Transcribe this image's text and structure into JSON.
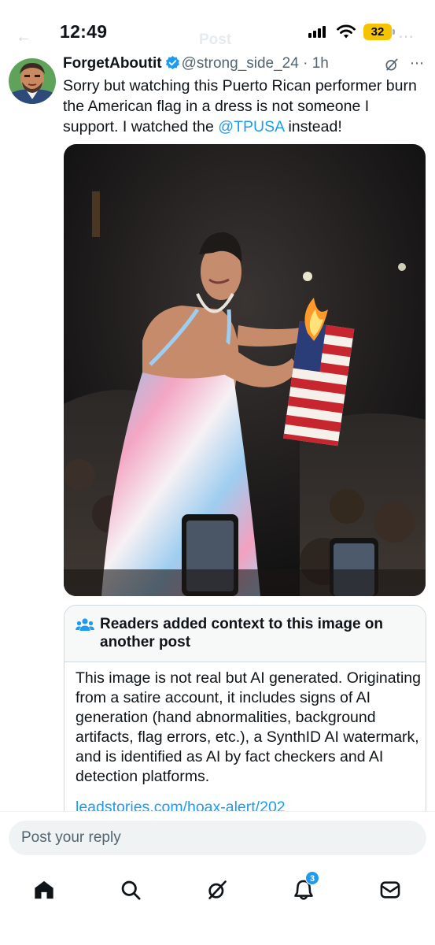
{
  "status_bar": {
    "time": "12:49",
    "battery": "32",
    "battery_color": "#f5c400"
  },
  "nav": {
    "back_icon": "arrow-left-icon",
    "title": "Post",
    "more_icon": "more-dots-icon"
  },
  "tweet": {
    "display_name": "ForgetAboutit",
    "handle": "@strong_side_24",
    "separator": " · ",
    "time": "1h",
    "verified_color": "#1d9bf0",
    "text_before": "Sorry but watching this Puerto Rican performer burn the American flag in a dress is not someone I support.  I watched the ",
    "mention": "@TPUSA",
    "text_after": " instead!",
    "more_icon": "more-dots-icon",
    "grok_icon": "grok-icon"
  },
  "community_note": {
    "icon": "people-icon",
    "title": "Readers added context to this image on another post",
    "body": "This image is not real but AI generated. Originating from a satire account, it includes signs of AI generation (hand abnormalities, background artifacts, flag errors, etc.), a SynthID AI watermark, and is identified as AI by fact checkers and AI detection platforms.",
    "link": "leadstories.com/hoax-alert/202"
  },
  "reply": {
    "placeholder": "Post your reply"
  },
  "tabbar": {
    "items": [
      "home-icon",
      "search-icon",
      "grok-icon",
      "notifications-icon",
      "messages-icon"
    ],
    "notification_count": "3",
    "accent": "#1d9bf0"
  }
}
